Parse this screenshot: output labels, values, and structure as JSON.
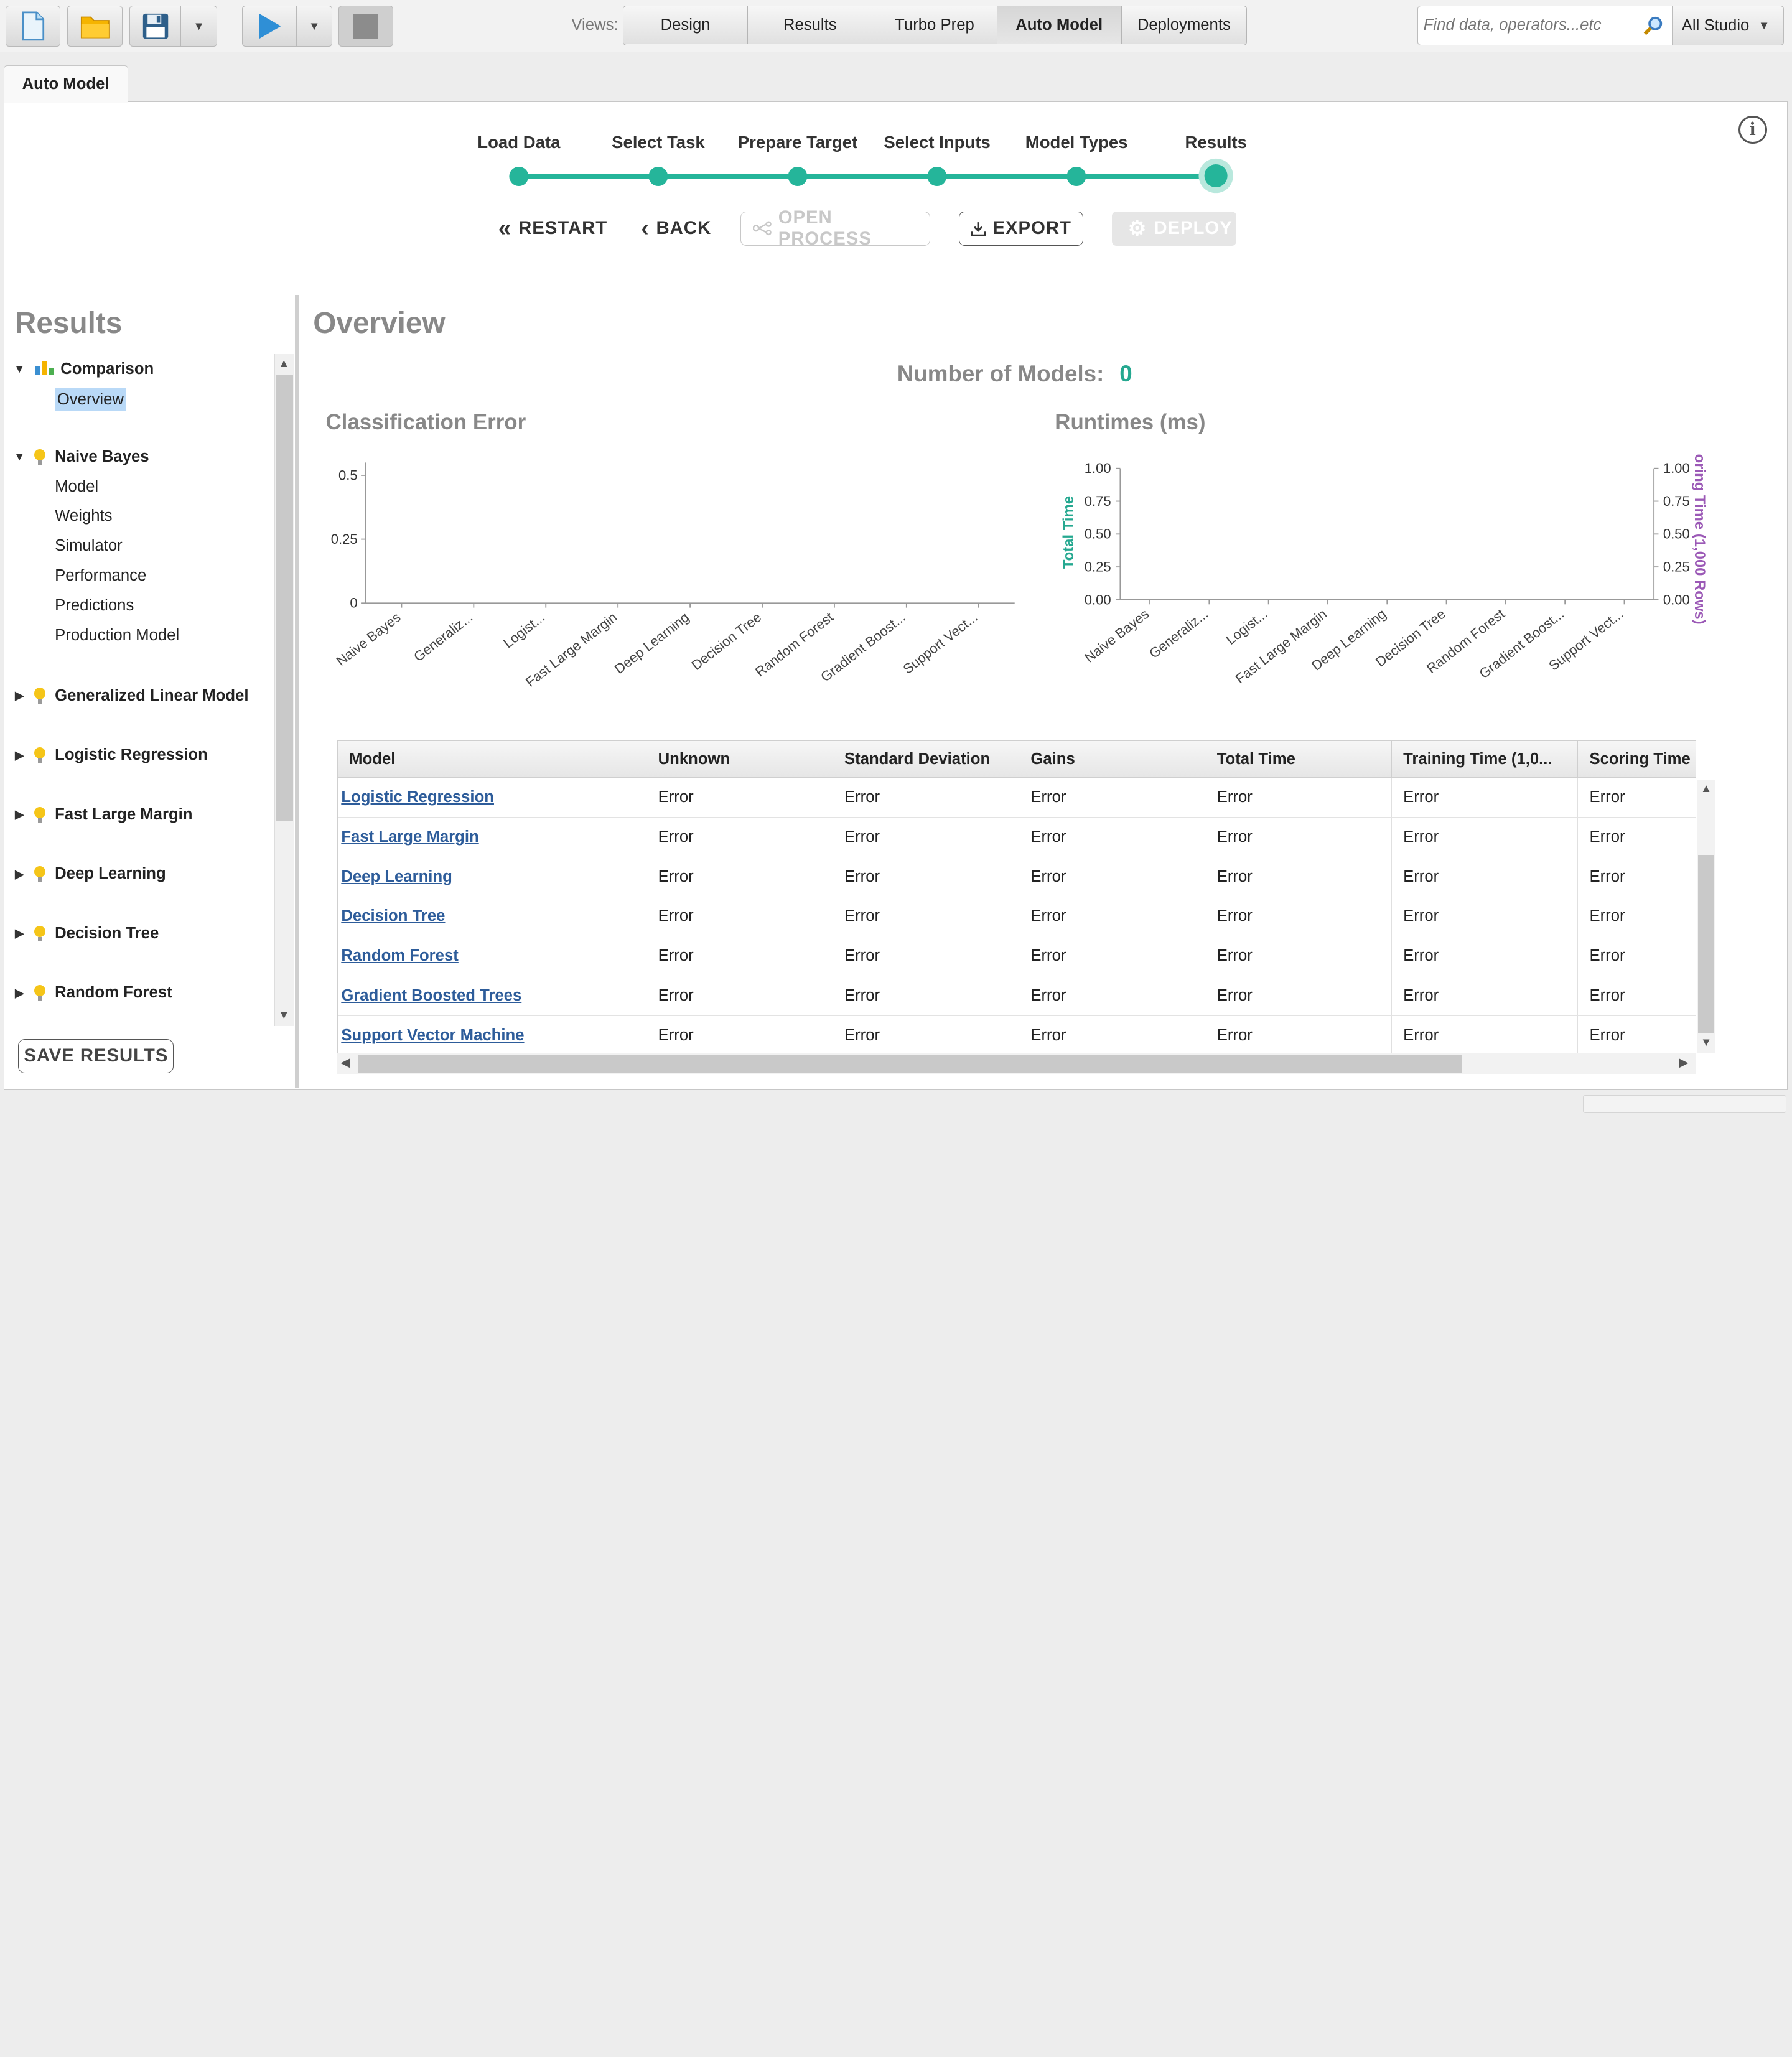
{
  "toolbar": {
    "views_label": "Views:",
    "views": [
      {
        "label": "Design",
        "active": false
      },
      {
        "label": "Results",
        "active": false
      },
      {
        "label": "Turbo Prep",
        "active": false
      },
      {
        "label": "Auto Model",
        "active": true
      },
      {
        "label": "Deployments",
        "active": false
      }
    ],
    "search_placeholder": "Find data, operators...etc",
    "studio_label": "All Studio"
  },
  "panel_tab": "Auto Model",
  "steps": [
    "Load Data",
    "Select Task",
    "Prepare Target",
    "Select Inputs",
    "Model Types",
    "Results"
  ],
  "actions": {
    "restart": "RESTART",
    "back": "BACK",
    "open_process": "OPEN PROCESS",
    "export": "EXPORT",
    "deploy": "DEPLOY"
  },
  "sidebar": {
    "title": "Results",
    "tree": [
      {
        "label": "Comparison",
        "group": true,
        "icon": "comparison-icon",
        "expanded": true
      },
      {
        "label": "Overview",
        "group": false,
        "selected": true
      },
      {
        "label": "Naive Bayes",
        "group": true,
        "icon": "lightbulb-icon",
        "expanded": true
      },
      {
        "label": "Model",
        "group": false
      },
      {
        "label": "Weights",
        "group": false
      },
      {
        "label": "Simulator",
        "group": false
      },
      {
        "label": "Performance",
        "group": false
      },
      {
        "label": "Predictions",
        "group": false
      },
      {
        "label": "Production Model",
        "group": false
      },
      {
        "label": "Generalized Linear Model",
        "group": true,
        "icon": "lightbulb-icon",
        "expanded": false
      },
      {
        "label": "Logistic Regression",
        "group": true,
        "icon": "lightbulb-icon",
        "expanded": false
      },
      {
        "label": "Fast Large Margin",
        "group": true,
        "icon": "lightbulb-icon",
        "expanded": false
      },
      {
        "label": "Deep Learning",
        "group": true,
        "icon": "lightbulb-icon",
        "expanded": false
      },
      {
        "label": "Decision Tree",
        "group": true,
        "icon": "lightbulb-icon",
        "expanded": false
      },
      {
        "label": "Random Forest",
        "group": true,
        "icon": "lightbulb-icon",
        "expanded": false
      }
    ],
    "save_label": "SAVE RESULTS"
  },
  "main": {
    "title": "Overview",
    "models_label": "Number of Models:",
    "models_count": "0"
  },
  "chart_data": [
    {
      "type": "bar",
      "title": "Classification Error",
      "categories": [
        "Naive Bayes",
        "Generaliz...",
        "Logist...",
        "Fast Large Margin",
        "Deep Learning",
        "Decision Tree",
        "Random Forest",
        "Gradient Boost...",
        "Support Vect..."
      ],
      "values": [],
      "yticks": [
        "0",
        "0.25",
        "0.5"
      ],
      "ylim": [
        0,
        0.55
      ]
    },
    {
      "type": "bar",
      "title": "Runtimes (ms)",
      "categories": [
        "Naive Bayes",
        "Generaliz...",
        "Logist...",
        "Fast Large Margin",
        "Deep Learning",
        "Decision Tree",
        "Random Forest",
        "Gradient Boost...",
        "Support Vect..."
      ],
      "series": [],
      "ylabel": "Total Time",
      "y2label": "oring Time (1,000 Rows)",
      "yticks": [
        "0.00",
        "0.25",
        "0.50",
        "0.75",
        "1.00"
      ],
      "y2ticks": [
        "0.00",
        "0.25",
        "0.50",
        "0.75",
        "1.00"
      ],
      "ylim": [
        0,
        1
      ],
      "colors": {
        "ylabel": "#25a890",
        "y2label": "#9b59b6"
      }
    }
  ],
  "table": {
    "columns": [
      "Model",
      "Unknown",
      "Standard Deviation",
      "Gains",
      "Total Time",
      "Training Time (1,0...",
      "Scoring Time"
    ],
    "rows": [
      [
        "Logistic Regression",
        "Error",
        "Error",
        "Error",
        "Error",
        "Error",
        "Error"
      ],
      [
        "Fast Large Margin",
        "Error",
        "Error",
        "Error",
        "Error",
        "Error",
        "Error"
      ],
      [
        "Deep Learning",
        "Error",
        "Error",
        "Error",
        "Error",
        "Error",
        "Error"
      ],
      [
        "Decision Tree",
        "Error",
        "Error",
        "Error",
        "Error",
        "Error",
        "Error"
      ],
      [
        "Random Forest",
        "Error",
        "Error",
        "Error",
        "Error",
        "Error",
        "Error"
      ],
      [
        "Gradient Boosted Trees",
        "Error",
        "Error",
        "Error",
        "Error",
        "Error",
        "Error"
      ],
      [
        "Support Vector Machine",
        "Error",
        "Error",
        "Error",
        "Error",
        "Error",
        "Error"
      ]
    ]
  },
  "colors": {
    "accent": "#25b59a",
    "link": "#2d5c9a"
  }
}
